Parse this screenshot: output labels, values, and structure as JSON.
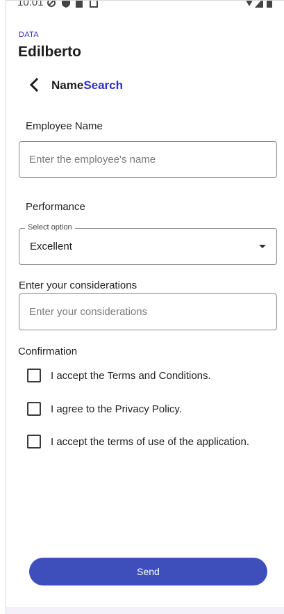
{
  "status_bar": {
    "time": "10:01"
  },
  "header": {
    "brand_small": "DATA",
    "brand_title": "Edilberto"
  },
  "nav": {
    "back_icon": "chevron-left-icon",
    "title_part1": "Name",
    "title_part2": "Search"
  },
  "form": {
    "employee_name": {
      "label": "Employee Name",
      "value": "",
      "placeholder": "Enter the employee's name"
    },
    "performance": {
      "label": "Performance",
      "select_legend": "Select option",
      "selected_value": "Excellent",
      "icon": "dropdown-arrow-icon"
    },
    "considerations": {
      "label": "Enter your considerations",
      "value": "",
      "placeholder": "Enter your considerations"
    },
    "confirmation": {
      "label": "Confirmation",
      "options": [
        {
          "label": "I accept the Terms and Conditions.",
          "checked": false
        },
        {
          "label": "I agree to the Privacy Policy.",
          "checked": false
        },
        {
          "label": "I accept the terms of use of the application.",
          "checked": false
        }
      ]
    }
  },
  "actions": {
    "send_label": "Send"
  },
  "colors": {
    "accent": "#2c2fcf",
    "button": "#3e4fbb"
  }
}
